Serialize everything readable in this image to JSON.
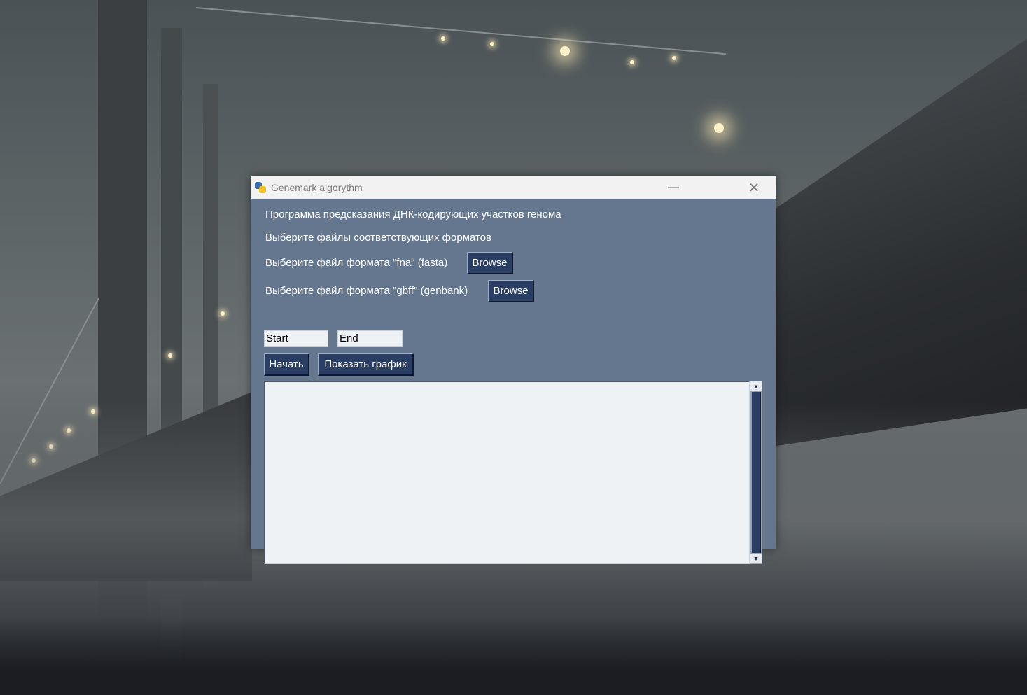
{
  "window": {
    "title": "Genemark algorythm",
    "minimize_glyph": "—",
    "close_glyph": "✕"
  },
  "main": {
    "heading": "Программа предсказания ДНК-кодирующих участков генома",
    "subheading": "Выберите файлы соответствующих форматов",
    "fna_label": "Выберите файл формата \"fna\" (fasta)",
    "fna_browse": "Browse",
    "gbff_label": "Выберите файл формата \"gbff\" (genbank)",
    "gbff_browse": "Browse",
    "start_value": "Start",
    "end_value": "End",
    "run_button": "Начать",
    "plot_button": "Показать график",
    "output_text": ""
  },
  "icons": {
    "app": "python-icon",
    "scroll_up": "▲",
    "scroll_down": "▼"
  },
  "colors": {
    "window_bg": "#65778f",
    "button_bg": "#2a3d63",
    "field_bg": "#eef2f5"
  }
}
